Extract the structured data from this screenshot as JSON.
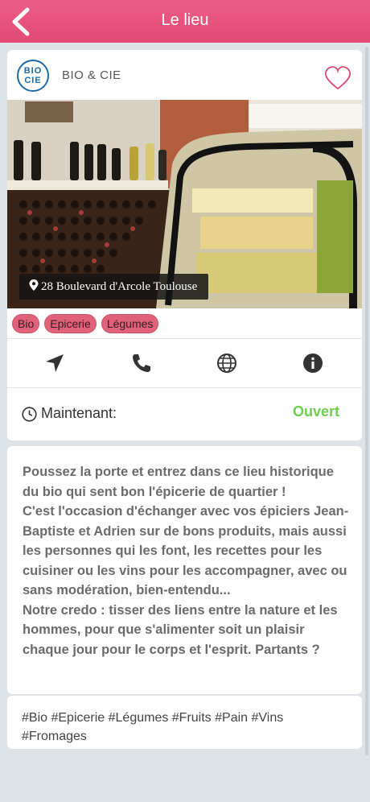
{
  "header": {
    "title": "Le lieu",
    "back_icon": "chevron-left-icon"
  },
  "place": {
    "logo_text": "BIO CIE",
    "name": "BIO & CIE",
    "favorite_icon": "heart-outline-icon",
    "address": "28 Boulevard d'Arcole Toulouse",
    "categories": [
      "Bio",
      "Epicerie",
      "Légumes"
    ]
  },
  "actions": [
    {
      "name": "directions",
      "icon": "navigation-arrow-icon"
    },
    {
      "name": "call",
      "icon": "phone-icon"
    },
    {
      "name": "website",
      "icon": "globe-icon"
    },
    {
      "name": "info",
      "icon": "info-icon"
    }
  ],
  "hours": {
    "label": "Maintenant:",
    "status": "Ouvert"
  },
  "description": [
    "Poussez la porte et entrez dans ce lieu historique du bio qui sent bon l'épicerie de quartier !",
    "C'est l'occasion d'échanger avec vos épiciers Jean-Baptiste et Adrien sur de bons produits, mais aussi les personnes qui les font, les recettes pour les cuisiner ou les vins pour les accompagner, avec ou sans modération, bien-entendu...",
    "Notre credo : tisser des liens entre la nature et les hommes, pour que s'alimenter soit un plaisir chaque jour pour le corps et l'esprit. Partants ?"
  ],
  "hashtags": "#Bio #Epicerie #Légumes #Fruits #Pain #Vins #Fromages",
  "colors": {
    "accent": "#e04a74",
    "open": "#6ccf4e",
    "chip": "#e2617a"
  }
}
